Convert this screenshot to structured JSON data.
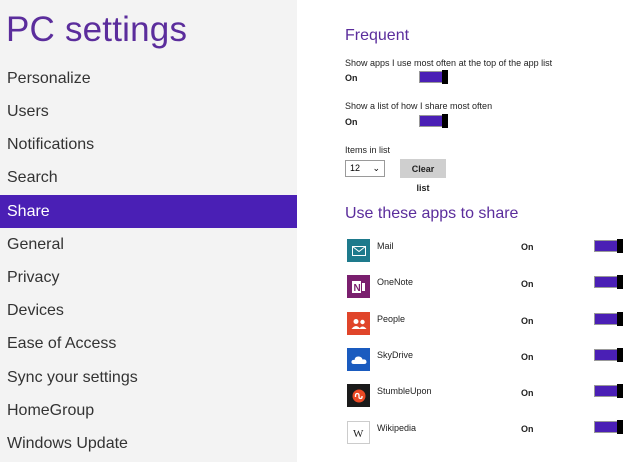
{
  "sidebar": {
    "title": "PC settings",
    "items": [
      {
        "label": "Personalize"
      },
      {
        "label": "Users"
      },
      {
        "label": "Notifications"
      },
      {
        "label": "Search"
      },
      {
        "label": "Share",
        "active": true
      },
      {
        "label": "General"
      },
      {
        "label": "Privacy"
      },
      {
        "label": "Devices"
      },
      {
        "label": "Ease of Access"
      },
      {
        "label": "Sync your settings"
      },
      {
        "label": "HomeGroup"
      },
      {
        "label": "Windows Update"
      }
    ]
  },
  "frequent": {
    "heading": "Frequent",
    "show_apps_label": "Show apps I use most often at the top of the app list",
    "show_apps_state": "On",
    "show_list_label": "Show a list of how I share most often",
    "show_list_state": "On",
    "items_label": "Items in list",
    "items_value": "12",
    "clear_label": "Clear list"
  },
  "apps": {
    "heading": "Use these apps to share",
    "list": [
      {
        "name": "Mail",
        "state": "On",
        "icon": "mail-icon",
        "color": "#1e7a8c"
      },
      {
        "name": "OneNote",
        "state": "On",
        "icon": "onenote-icon",
        "color": "#7a1f6e"
      },
      {
        "name": "People",
        "state": "On",
        "icon": "people-icon",
        "color": "#e0452a"
      },
      {
        "name": "SkyDrive",
        "state": "On",
        "icon": "skydrive-icon",
        "color": "#1a5bbf"
      },
      {
        "name": "StumbleUpon",
        "state": "On",
        "icon": "stumbleupon-icon",
        "color": "#1a1a1a"
      },
      {
        "name": "Wikipedia",
        "state": "On",
        "icon": "wikipedia-icon",
        "color": "#ffffff"
      }
    ]
  },
  "colors": {
    "accent": "#4a1fb5",
    "title": "#5b2d9c"
  }
}
